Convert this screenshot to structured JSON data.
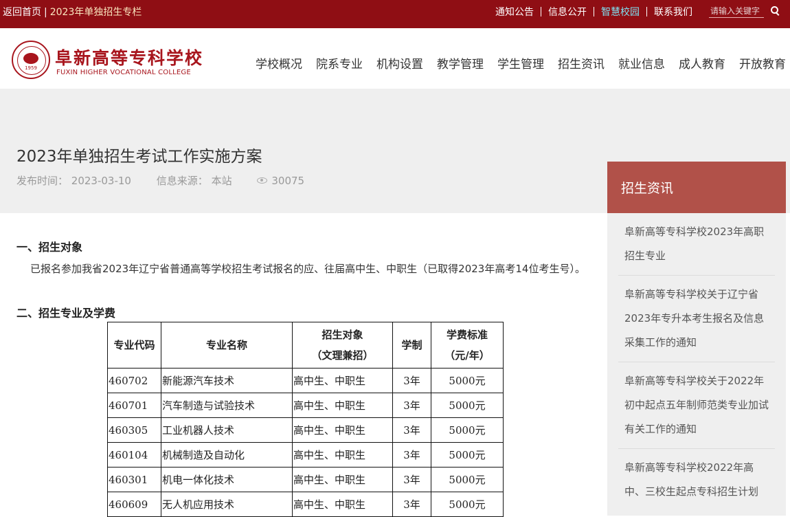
{
  "topbar": {
    "home": "返回首页",
    "special": "2023年单独招生专栏",
    "links": [
      "通知公告",
      "信息公开",
      "智慧校园",
      "联系我们"
    ],
    "search_placeholder": "请输入关键字"
  },
  "header": {
    "school_cn": "阜新高等专科学校",
    "school_en": "FUXIN HIGHER VOCATIONAL COLLEGE",
    "emblem_year": "1959",
    "nav": [
      "学校概况",
      "院系专业",
      "机构设置",
      "教学管理",
      "学生管理",
      "招生资讯",
      "就业信息",
      "成人教育",
      "开放教育"
    ]
  },
  "article": {
    "title": "2023年单独招生考试工作实施方案",
    "publish_label": "发布时间：",
    "publish_date": "2023-03-10",
    "source_label": "信息来源：",
    "source": "本站",
    "views": "30075",
    "section1": "一、招生对象",
    "para1": "已报名参加我省2023年辽宁省普通高等学校招生考试报名的应、往届高中生、中职生（已取得2023年高考14位考生号）。",
    "section2": "二、招生专业及学费"
  },
  "table": {
    "headers": {
      "code": "专业代码",
      "name": "专业名称",
      "target_1": "招生对象",
      "target_2": "（文理兼招）",
      "years": "学制",
      "fee_1": "学费标准",
      "fee_2": "（元/年）"
    },
    "rows": [
      {
        "code": "460702",
        "name": "新能源汽车技术",
        "target": "高中生、中职生",
        "years": "3年",
        "fee": "5000元"
      },
      {
        "code": "460701",
        "name": "汽车制造与试验技术",
        "target": "高中生、中职生",
        "years": "3年",
        "fee": "5000元"
      },
      {
        "code": "460305",
        "name": "工业机器人技术",
        "target": "高中生、中职生",
        "years": "3年",
        "fee": "5000元"
      },
      {
        "code": "460104",
        "name": "机械制造及自动化",
        "target": "高中生、中职生",
        "years": "3年",
        "fee": "5000元"
      },
      {
        "code": "460301",
        "name": "机电一体化技术",
        "target": "高中生、中职生",
        "years": "3年",
        "fee": "5000元"
      },
      {
        "code": "460609",
        "name": "无人机应用技术",
        "target": "高中生、中职生",
        "years": "3年",
        "fee": "5000元"
      }
    ]
  },
  "sidebar": {
    "title": "招生资讯",
    "items": [
      "阜新高等专科学校2023年高职招生专业",
      "阜新高等专科学校关于辽宁省2023年专升本考生报名及信息采集工作的通知",
      "阜新高等专科学校关于2022年初中起点五年制师范类专业加试有关工作的通知",
      "阜新高等专科学校2022年高中、三校生起点专科招生计划"
    ]
  }
}
